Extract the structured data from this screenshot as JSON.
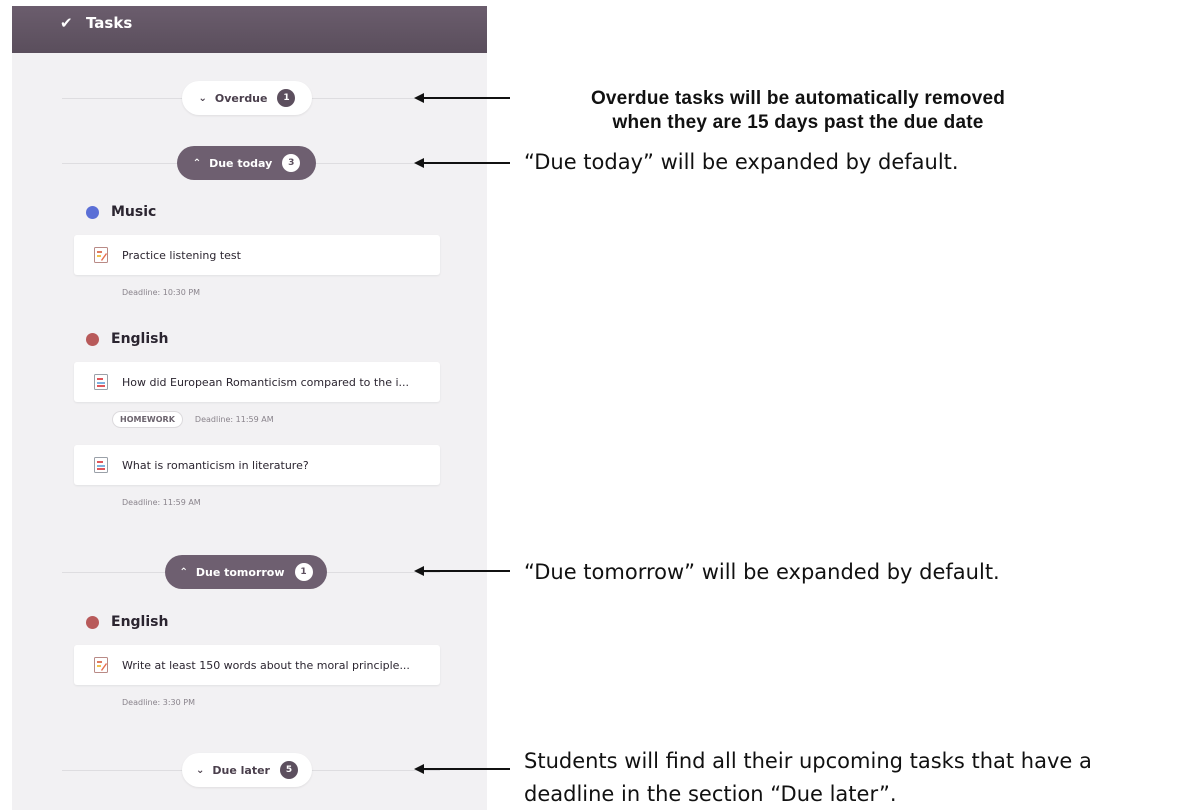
{
  "panel": {
    "title": "Tasks",
    "groups": {
      "overdue": {
        "label": "Overdue",
        "count": "1",
        "chevron": "v"
      },
      "today": {
        "label": "Due today",
        "count": "3",
        "chevron": "^"
      },
      "tomorrow": {
        "label": "Due tomorrow",
        "count": "1",
        "chevron": "^"
      },
      "later": {
        "label": "Due later",
        "count": "5",
        "chevron": "v"
      }
    },
    "subjects": {
      "music": "Music",
      "english1": "English",
      "english2": "English"
    },
    "tasks": [
      {
        "title": "Practice listening test",
        "deadline": "Deadline: 10:30 PM",
        "icon": "assignment-icon"
      },
      {
        "title": "How did European Romanticism compared to the i...",
        "badge": "HOMEWORK",
        "deadline": "Deadline: 11:59 AM",
        "icon": "document-icon"
      },
      {
        "title": "What is romanticism in literature?",
        "deadline": "Deadline: 11:59 AM",
        "icon": "document-icon"
      },
      {
        "title": "Write at least 150 words about the moral principle...",
        "deadline": "Deadline: 3:30 PM",
        "icon": "assignment-icon"
      }
    ],
    "colors": {
      "music": "#5b6fd6",
      "english": "#b85a5a",
      "header": "#5e5160"
    }
  },
  "annotations": {
    "overdue_line1": "Overdue tasks will be automatically removed",
    "overdue_line2": "when they are 15 days past the due date",
    "today": "“Due today” will be expanded by default.",
    "tomorrow": "“Due tomorrow” will be expanded by default.",
    "later_line1": "Students will find all their upcoming tasks that have a",
    "later_line2": "deadline in the section “Due later”."
  }
}
